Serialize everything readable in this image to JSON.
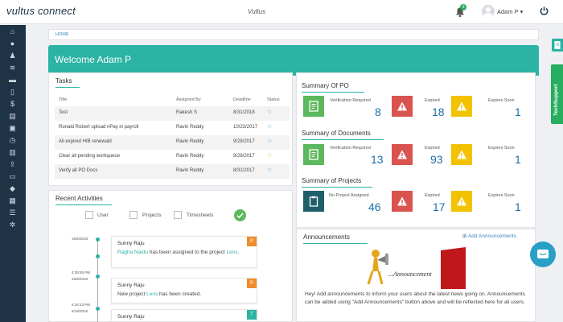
{
  "header": {
    "logo_text": "vultus connect",
    "center_logo": "Vultus",
    "notification_count": "0",
    "user_name": "Adam P ▾"
  },
  "breadcrumb": "HOME",
  "welcome": "Welcome Adam P",
  "tasks": {
    "title": "Tasks",
    "columns": [
      "Title",
      "Assigned By",
      "Deadline",
      "Status"
    ],
    "rows": [
      {
        "title": "Test",
        "assigned_by": "Rakesh S",
        "deadline": "8/31/2018",
        "status": "☆"
      },
      {
        "title": "Ronald Robert upload nPay in payroll",
        "assigned_by": "Ravin Reddy",
        "deadline": "10/23/2017",
        "status": "☆"
      },
      {
        "title": "All expired HIB renewald",
        "assigned_by": "Ravin Reddy",
        "deadline": "9/28/2017",
        "status": "☆"
      },
      {
        "title": "Clear all pending workqueue",
        "assigned_by": "Ravin Reddy",
        "deadline": "9/28/2017",
        "status": "☆"
      },
      {
        "title": "Verify all PO Docs",
        "assigned_by": "Ravin Reddy",
        "deadline": "8/31/2017",
        "status": "☆"
      }
    ]
  },
  "summary_po": {
    "title": "Summary Of PO",
    "verification_label": "Verification Required",
    "verification_value": "8",
    "expired_label": "Expired",
    "expired_value": "18",
    "expires_soon_label": "Expires Soon",
    "expires_soon_value": "1"
  },
  "summary_docs": {
    "title": "Summary of Documents",
    "verification_label": "Verification Required",
    "verification_value": "13",
    "expired_label": "Expired",
    "expired_value": "93",
    "expires_soon_label": "Expires Soon",
    "expires_soon_value": "1"
  },
  "summary_projects": {
    "title": "Summary of Projects",
    "no_project_label": "No Project Assigned",
    "no_project_value": "46",
    "expired_label": "Expired",
    "expired_value": "17",
    "expires_soon_label": "Expires Soon",
    "expires_soon_value": "1"
  },
  "recent": {
    "title": "Recent Activities",
    "filters": [
      "User",
      "Projects",
      "Timesheets"
    ],
    "items": [
      {
        "time": "15/6/2018",
        "name": "Sunny Raju",
        "text_link1": "Ragha Naidu",
        "text_mid": " has been assigned to the project ",
        "text_link2": "Lens",
        "text_end": ".",
        "badge": "P"
      },
      {
        "time": "4:39:55 PM",
        "time2": "15/6/2018",
        "name": "Sunny Raju",
        "text_link1": "",
        "text_mid": "New project ",
        "text_link2": "Lens",
        "text_end": " has been created.",
        "badge": "P"
      },
      {
        "time": "4:34:43 PM",
        "time2": "6/18/2018",
        "name": "Sunny Raju",
        "badge": "T"
      }
    ]
  },
  "announcements": {
    "title": "Announcements",
    "add_label": "Add Announcements",
    "image_caption": "...Announcement",
    "text": "Hey! Add announcements to inform your users about the latest news going on. Announcements can be added using \"Add Announcements\" button above and will be reflected here for all users."
  },
  "techsupport": "TechSupport",
  "colors": {
    "accent": "#2bb3a3",
    "sidebar": "#1f3347",
    "green": "#5cb85c",
    "red": "#d9534f",
    "yellow": "#f2c200",
    "number": "#1f6fa8"
  }
}
